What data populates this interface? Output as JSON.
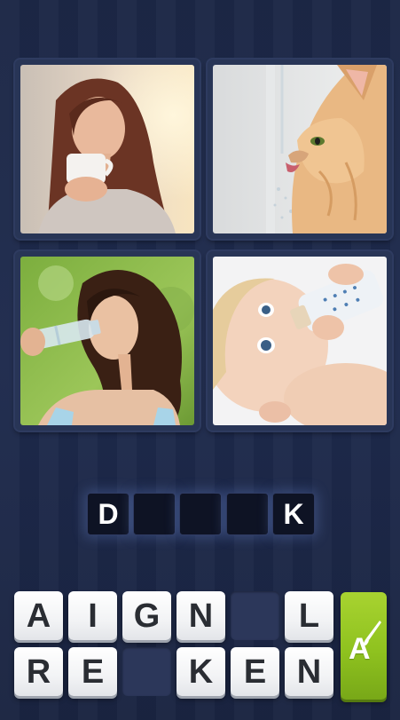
{
  "puzzle": {
    "photos": [
      {
        "name": "woman-drinking-coffee"
      },
      {
        "name": "cat-drinking-water"
      },
      {
        "name": "woman-drinking-bottled-water"
      },
      {
        "name": "baby-drinking-bottle"
      }
    ]
  },
  "answer": {
    "slots": [
      "D",
      "",
      "",
      "",
      "K"
    ]
  },
  "keyboard": {
    "row1": [
      "A",
      "I",
      "G",
      "N",
      "",
      "L"
    ],
    "row2": [
      "R",
      "E",
      "",
      "K",
      "E",
      "N"
    ]
  },
  "hint_button": {
    "letter": "A",
    "icon": "brush-icon",
    "color": "#9ac826"
  }
}
